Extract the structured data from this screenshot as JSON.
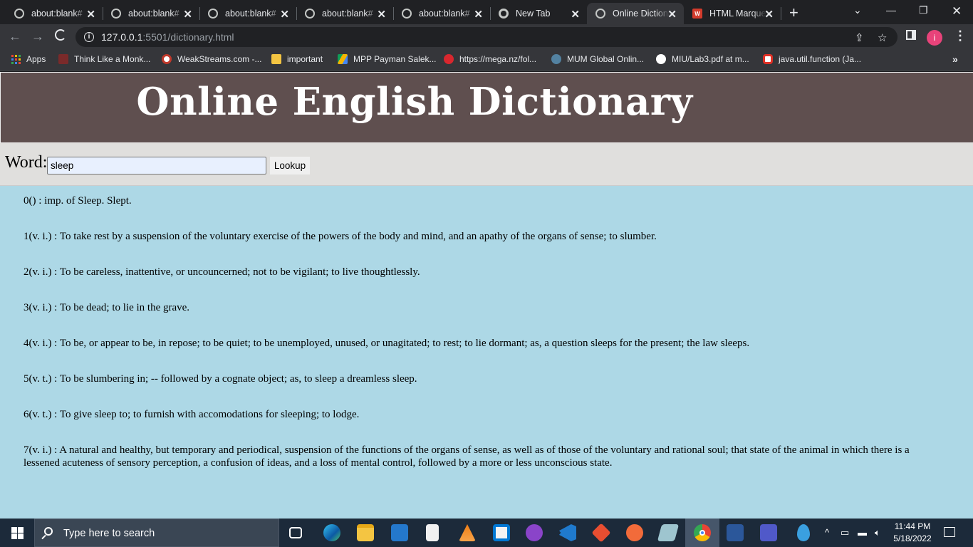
{
  "browser": {
    "tabs": [
      {
        "title": "about:blank#",
        "icon": "globe-icon"
      },
      {
        "title": "about:blank#",
        "icon": "globe-icon"
      },
      {
        "title": "about:blank#",
        "icon": "globe-icon"
      },
      {
        "title": "about:blank#",
        "icon": "globe-icon"
      },
      {
        "title": "about:blank#",
        "icon": "globe-icon"
      },
      {
        "title": "New Tab",
        "icon": "chrome-icon"
      },
      {
        "title": "Online Dictionary",
        "icon": "globe-icon",
        "active": true
      },
      {
        "title": "HTML Marquee",
        "icon": "marquee-icon"
      }
    ],
    "url_host": "127.0.0.1",
    "url_path": ":5501/dictionary.html",
    "profile_initial": "i",
    "bookmarks": [
      {
        "label": "Apps",
        "icon": "apps-grid-icon"
      },
      {
        "label": "Think Like a Monk...",
        "icon": "bookmark-icon"
      },
      {
        "label": "WeakStreams.com -...",
        "icon": "soccer-icon"
      },
      {
        "label": "important",
        "icon": "folder-icon"
      },
      {
        "label": "MPP Payman Salek...",
        "icon": "drive-icon"
      },
      {
        "label": "https://mega.nz/fol...",
        "icon": "mega-icon"
      },
      {
        "label": "MUM Global Onlin...",
        "icon": "java-icon"
      },
      {
        "label": "MIU/Lab3.pdf at m...",
        "icon": "github-icon"
      },
      {
        "label": "java.util.function (Ja...",
        "icon": "oracle-icon"
      }
    ]
  },
  "page": {
    "title": "Online English Dictionary",
    "word_label": "Word:",
    "input_value": "sleep",
    "button_label": "Lookup",
    "definitions": [
      "0() : imp. of Sleep. Slept.",
      "1(v. i.) : To take rest by a suspension of the voluntary exercise of the powers of the body and mind, and an apathy of the organs of sense; to slumber.",
      "2(v. i.) : To be careless, inattentive, or uncouncerned; not to be vigilant; to live thoughtlessly.",
      "3(v. i.) : To be dead; to lie in the grave.",
      "4(v. i.) : To be, or appear to be, in repose; to be quiet; to be unemployed, unused, or unagitated; to rest; to lie dormant; as, a question sleeps for the present; the law sleeps.",
      "5(v. t.) : To be slumbering in; -- followed by a cognate object; as, to sleep a dreamless sleep.",
      "6(v. t.) : To give sleep to; to furnish with accomodations for sleeping; to lodge.",
      "7(v. i.) : A natural and healthy, but temporary and periodical, suspension of the functions of the organs of sense, as well as of those of the voluntary and rational soul; that state of the animal in which there is a lessened acuteness of sensory perception, a confusion of ideas, and a loss of mental control, followed by a more or less unconscious state."
    ]
  },
  "taskbar": {
    "search_placeholder": "Type here to search",
    "time": "11:44 PM",
    "date": "5/18/2022",
    "apps": [
      "task-view-icon",
      "edge-icon",
      "file-explorer-icon",
      "mail-icon",
      "notepad-icon",
      "vlc-icon",
      "store-icon",
      "github-desktop-icon",
      "vscode-icon",
      "git-icon",
      "postman-icon",
      "app-icon",
      "chrome-icon",
      "word-icon",
      "teams-icon",
      "dropbox-icon"
    ]
  },
  "colors": {
    "page_bg": "#add8e6",
    "header_bg": "#5f4f4f",
    "lookup_bar_bg": "#e0dfdd"
  }
}
